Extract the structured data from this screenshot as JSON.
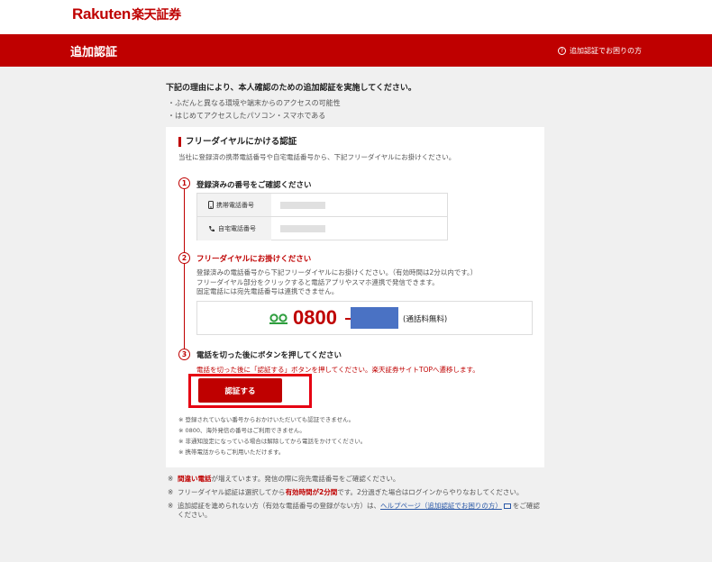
{
  "logo": {
    "en": "Rakuten",
    "jp": "楽天証券"
  },
  "header": {
    "title": "追加認証",
    "help_icon": "?",
    "help_label": "追加認証でお困りの方"
  },
  "intro": {
    "text": "下記の理由により、本人確認のための追加認証を実施してください。",
    "reasons": [
      "ふだんと異なる環境や端末からのアクセスの可能性",
      "はじめてアクセスしたパソコン・スマホである"
    ]
  },
  "card": {
    "title": "フリーダイヤルにかける認証",
    "desc": "当社に登録済の携帯電話番号や自宅電話番号から、下記フリーダイヤルにお掛けください。",
    "step1": {
      "num": "1",
      "title": "登録済みの番号をご確認ください",
      "rows": [
        {
          "icon": "mobile-phone-icon",
          "label": "携帯電話番号"
        },
        {
          "icon": "home-phone-icon",
          "label": "自宅電話番号"
        }
      ]
    },
    "step2": {
      "num": "2",
      "title": "フリーダイヤルにお掛けください",
      "desc_lines": [
        "登録済みの電話番号から下記フリーダイヤルにお掛けください。（有効時間は2分以内です。）",
        "フリーダイヤル部分をクリックすると電話アプリやスマホ連携で発信できます。",
        "固定電話には宛先電話番号は連携できません。"
      ],
      "number_prefix": "0800",
      "note": "(通話料無料)"
    },
    "step3": {
      "num": "3",
      "title": "電話を切った後にボタンを押してください",
      "note": "電話を切った後に「認証する」ボタンを押してください。楽天証券サイトTOPへ遷移します。",
      "button_label": "認証する"
    },
    "footnotes": [
      "登録されていない番号からおかけいただいても認証できません。",
      "0800、海外発信の番号はご利用できません。",
      "非通知設定になっている場合は解除してから電話をかけてください。",
      "携帯電話からもご利用いただけます。"
    ]
  },
  "bottom_notes": {
    "mark": "※",
    "n1": {
      "emph": "間違い電話",
      "rest": "が増えています。発信の際に宛先電話番号をご確認ください。"
    },
    "n2": {
      "pre": "フリーダイヤル認証は選択してから",
      "emph": "有効時間が2分間",
      "post": "です。2分過ぎた場合はログインからやりなおしてください。"
    },
    "n3": {
      "pre": "追加認証を進められない方（有効な電話番号の登録がない方）は、",
      "link": "ヘルプページ（追加認証でお困りの方）",
      "post": "をご確認ください。"
    }
  },
  "colors": {
    "brand": "#bf0000",
    "masked_number": "#4a72c4",
    "freedial_green": "#2e9e3e"
  }
}
